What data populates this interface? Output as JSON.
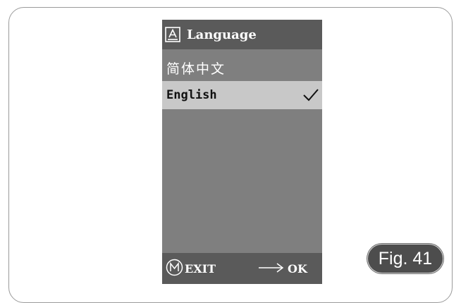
{
  "screen": {
    "title_icon": "a-box-icon",
    "title": "Language",
    "items": [
      {
        "label": "简体中文",
        "selected": false
      },
      {
        "label": "English",
        "selected": true
      }
    ],
    "selected_mark": "checkmark-icon",
    "footer": {
      "exit_icon": "m-circle-icon",
      "exit_label": "EXIT",
      "ok_icon": "right-arrow-icon",
      "ok_label": "OK"
    }
  },
  "figure_label": "Fig. 41",
  "colors": {
    "screen_bg": "#7f7f7f",
    "bar_bg": "#5a5a5a",
    "selected_bg": "#c8c8c8",
    "badge_bg": "#4d4d4d"
  }
}
